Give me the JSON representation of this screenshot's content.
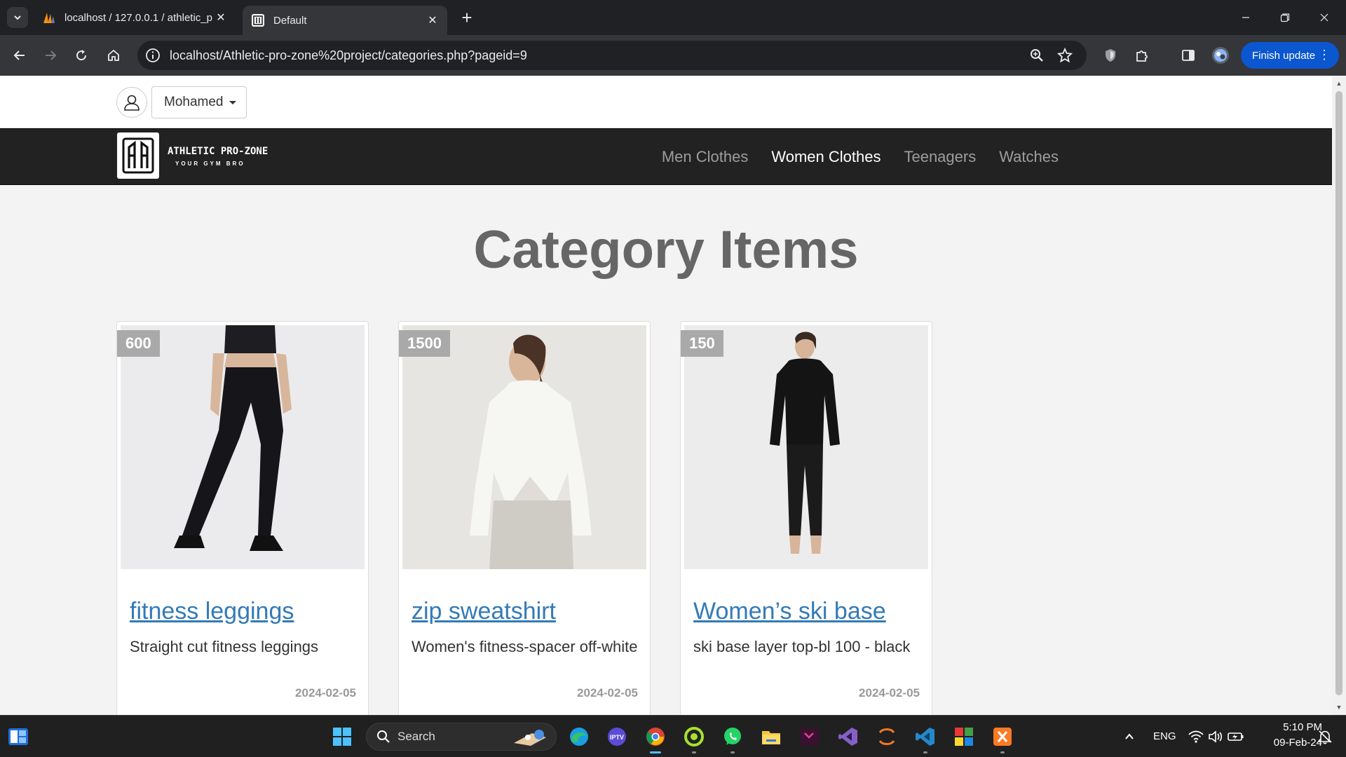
{
  "browser": {
    "tabs": [
      {
        "title": "localhost / 127.0.0.1 / athletic_p",
        "active": false
      },
      {
        "title": "Default",
        "active": true
      }
    ],
    "url": "localhost/Athletic-pro-zone%20project/categories.php?pageid=9",
    "finish_update_label": "Finish update"
  },
  "site": {
    "user": {
      "name": "Mohamed"
    },
    "brand": {
      "name": "ATHLETIC PRO-ZONE",
      "tagline": "YOUR GYM BRO"
    },
    "nav": [
      {
        "label": "Men Clothes",
        "active": false
      },
      {
        "label": "Women Clothes",
        "active": true
      },
      {
        "label": "Teenagers",
        "active": false
      },
      {
        "label": "Watches",
        "active": false
      }
    ],
    "heading": "Category Items",
    "items": [
      {
        "price": "600",
        "title": "fitness leggings",
        "description": "Straight cut fitness leggings",
        "date": "2024-02-05"
      },
      {
        "price": "1500",
        "title": "zip sweatshirt",
        "description": "Women's fitness-spacer off-white",
        "date": "2024-02-05"
      },
      {
        "price": "150",
        "title": "Women’s ski base",
        "description": "ski base layer top-bl 100 - black",
        "date": "2024-02-05"
      }
    ]
  },
  "taskbar": {
    "search_label": "Search",
    "language": "ENG",
    "time": "5:10 PM",
    "date": "09-Feb-24"
  },
  "colors": {
    "link_blue": "#337ab7",
    "navbar": "#222222",
    "price_badge": "#a9a9a9",
    "finish_button": "#0b57d0"
  }
}
